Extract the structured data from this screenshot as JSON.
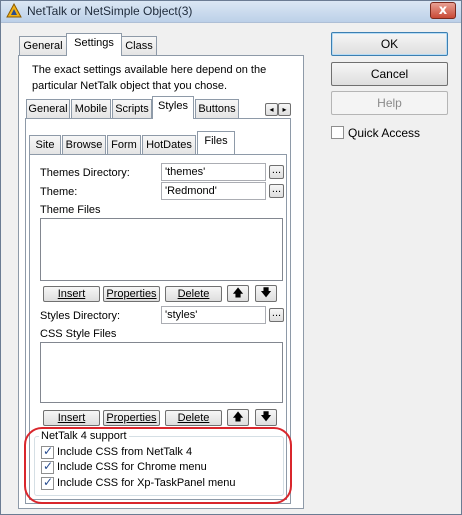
{
  "window": {
    "title": "NetTalk or NetSimple Object(3)",
    "close_glyph": "x"
  },
  "main_tabs": [
    "General",
    "Settings",
    "Class"
  ],
  "info_text": [
    "The exact settings available here depend on the",
    "particular NetTalk object that you chose."
  ],
  "sub_tabs": [
    "General",
    "Mobile",
    "Scripts",
    "Styles",
    "Buttons"
  ],
  "styles_tabs": [
    "Site",
    "Browse",
    "Form",
    "HotDates",
    "Files"
  ],
  "files": {
    "themes_dir_label": "Themes Directory:",
    "themes_dir_value": "'themes'",
    "theme_label": "Theme:",
    "theme_value": "'Redmond'",
    "theme_files_label": "Theme Files",
    "styles_dir_label": "Styles Directory:",
    "styles_dir_value": "'styles'",
    "css_files_label": "CSS Style Files",
    "browse_glyph": "...",
    "list_buttons": {
      "insert": "Insert",
      "properties": "Properties",
      "delete": "Delete"
    }
  },
  "support": {
    "group_label": "NetTalk 4 support",
    "options": [
      {
        "label": "Include CSS from NetTalk 4",
        "checked": true
      },
      {
        "label": "Include CSS for Chrome menu",
        "checked": true
      },
      {
        "label": "Include CSS for Xp-TaskPanel menu",
        "checked": true
      }
    ],
    "highlight_color": "#d9262c"
  },
  "side": {
    "ok": "OK",
    "cancel": "Cancel",
    "help": "Help",
    "quick_access": "Quick Access",
    "quick_access_checked": false
  }
}
